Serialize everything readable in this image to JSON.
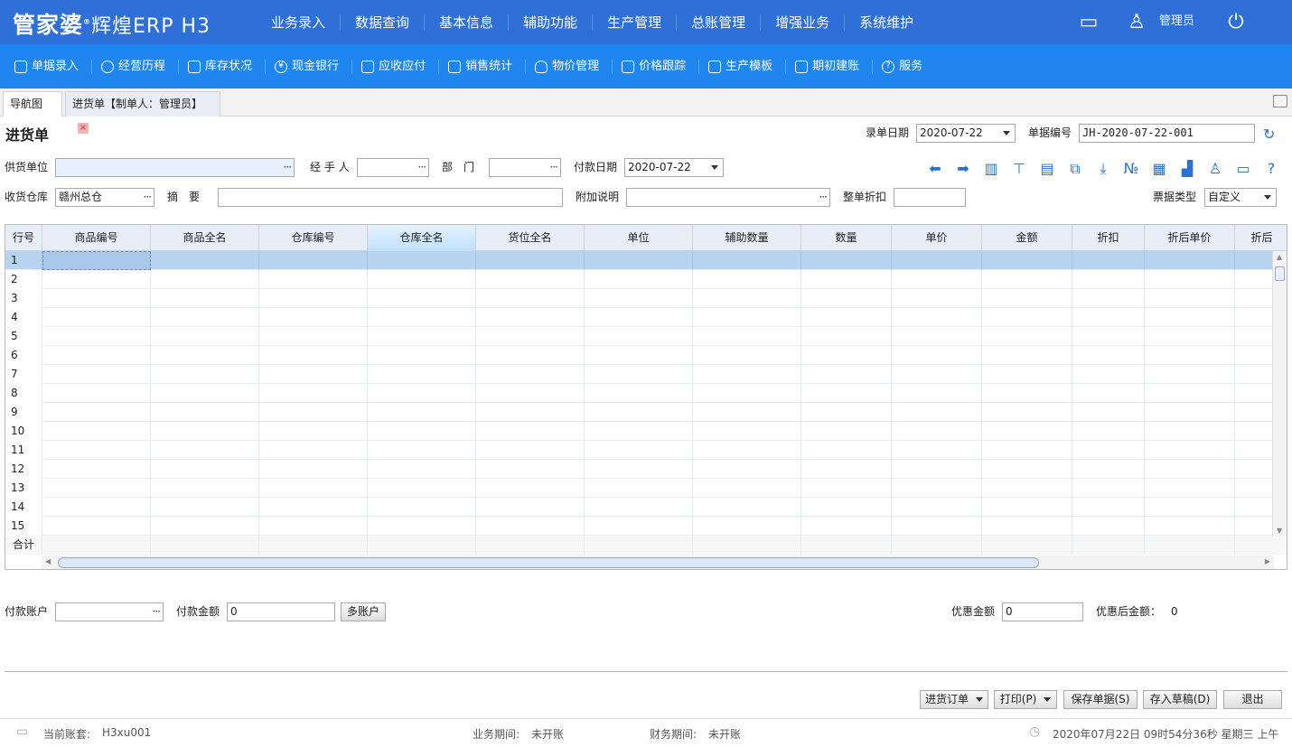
{
  "app": {
    "logo_main": "管家婆",
    "logo_sub": "辉煌ERP H3"
  },
  "main_nav": [
    "业务录入",
    "数据查询",
    "基本信息",
    "辅助功能",
    "生产管理",
    "总账管理",
    "增强业务",
    "系统维护"
  ],
  "user": {
    "name": "管理员"
  },
  "sub_nav": [
    "单据录入",
    "经营历程",
    "库存状况",
    "现金银行",
    "应收应付",
    "销售统计",
    "物价管理",
    "价格跟踪",
    "生产模板",
    "期初建账",
    "服务"
  ],
  "tabs": {
    "nav": "导航图",
    "active": "进货单【制单人：管理员】"
  },
  "form": {
    "title": "进货单",
    "entry_date_label": "录单日期",
    "entry_date": "2020-07-22",
    "doc_no_label": "单据编号",
    "doc_no": "JH-2020-07-22-001",
    "supplier_label": "供货单位",
    "supplier": "",
    "handler_label": "经 手 人",
    "handler": "",
    "dept_label": "部　门",
    "dept": "",
    "pay_date_label": "付款日期",
    "pay_date": "2020-07-22",
    "warehouse_label": "收货仓库",
    "warehouse": "赣州总仓",
    "summary_label": "摘　要",
    "summary": "",
    "extra_label": "附加说明",
    "extra": "",
    "discount_label": "整单折扣",
    "discount": "",
    "invoice_label": "票据类型",
    "invoice": "自定义"
  },
  "grid": {
    "columns": [
      "行号",
      "商品编号",
      "商品全名",
      "仓库编号",
      "仓库全名",
      "货位全名",
      "单位",
      "辅助数量",
      "数量",
      "单价",
      "金额",
      "折扣",
      "折后单价",
      "折后"
    ],
    "rows": [
      "1",
      "2",
      "3",
      "4",
      "5",
      "6",
      "7",
      "8",
      "9",
      "10",
      "11",
      "12",
      "13",
      "14",
      "15"
    ],
    "total_label": "合计"
  },
  "payment": {
    "account_label": "付款账户",
    "account": "",
    "amount_label": "付款金额",
    "amount": "0",
    "multi_btn": "多账户",
    "discount_amt_label": "优惠金额",
    "discount_amt": "0",
    "after_label": "优惠后金额：",
    "after_value": "0"
  },
  "actions": {
    "order": "进货订单",
    "print": "打印(P)",
    "save": "保存单据(S)",
    "draft": "存入草稿(D)",
    "exit": "退出"
  },
  "status": {
    "account_label": "当前账套:",
    "account": "H3xu001",
    "biz_period_label": "业务期间:",
    "biz_period": "未开账",
    "fin_period_label": "财务期间:",
    "fin_period": "未开账",
    "datetime": "2020年07月22日 09时54分36秒 星期三 上午"
  }
}
